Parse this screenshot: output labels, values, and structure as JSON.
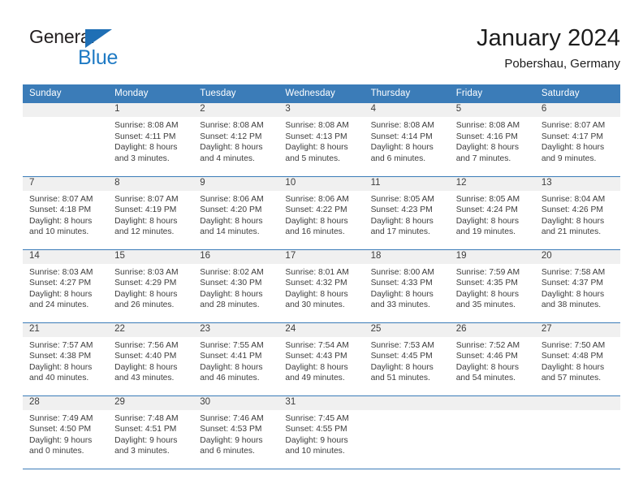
{
  "logo": {
    "word_dark": "General",
    "word_blue": "Blue",
    "triangle_color": "#1f6fb5",
    "blue_color": "#1f7ac4"
  },
  "header": {
    "title": "January 2024",
    "subtitle": "Pobershau, Germany"
  },
  "theme": {
    "header_blue": "#3b7cb8",
    "daynum_band": "#f0f0f0",
    "text": "#3d3d3d"
  },
  "labels": {
    "sunrise_prefix": "Sunrise:",
    "sunset_prefix": "Sunset:",
    "daylight_prefix": "Daylight:"
  },
  "weekday_headers": [
    "Sunday",
    "Monday",
    "Tuesday",
    "Wednesday",
    "Thursday",
    "Friday",
    "Saturday"
  ],
  "weeks": [
    [
      {
        "day": "",
        "empty": true,
        "lines": []
      },
      {
        "day": "1",
        "lines": [
          "Sunrise: 8:08 AM",
          "Sunset: 4:11 PM",
          "Daylight: 8 hours",
          "and 3 minutes."
        ]
      },
      {
        "day": "2",
        "lines": [
          "Sunrise: 8:08 AM",
          "Sunset: 4:12 PM",
          "Daylight: 8 hours",
          "and 4 minutes."
        ]
      },
      {
        "day": "3",
        "lines": [
          "Sunrise: 8:08 AM",
          "Sunset: 4:13 PM",
          "Daylight: 8 hours",
          "and 5 minutes."
        ]
      },
      {
        "day": "4",
        "lines": [
          "Sunrise: 8:08 AM",
          "Sunset: 4:14 PM",
          "Daylight: 8 hours",
          "and 6 minutes."
        ]
      },
      {
        "day": "5",
        "lines": [
          "Sunrise: 8:08 AM",
          "Sunset: 4:16 PM",
          "Daylight: 8 hours",
          "and 7 minutes."
        ]
      },
      {
        "day": "6",
        "lines": [
          "Sunrise: 8:07 AM",
          "Sunset: 4:17 PM",
          "Daylight: 8 hours",
          "and 9 minutes."
        ]
      }
    ],
    [
      {
        "day": "7",
        "lines": [
          "Sunrise: 8:07 AM",
          "Sunset: 4:18 PM",
          "Daylight: 8 hours",
          "and 10 minutes."
        ]
      },
      {
        "day": "8",
        "lines": [
          "Sunrise: 8:07 AM",
          "Sunset: 4:19 PM",
          "Daylight: 8 hours",
          "and 12 minutes."
        ]
      },
      {
        "day": "9",
        "lines": [
          "Sunrise: 8:06 AM",
          "Sunset: 4:20 PM",
          "Daylight: 8 hours",
          "and 14 minutes."
        ]
      },
      {
        "day": "10",
        "lines": [
          "Sunrise: 8:06 AM",
          "Sunset: 4:22 PM",
          "Daylight: 8 hours",
          "and 16 minutes."
        ]
      },
      {
        "day": "11",
        "lines": [
          "Sunrise: 8:05 AM",
          "Sunset: 4:23 PM",
          "Daylight: 8 hours",
          "and 17 minutes."
        ]
      },
      {
        "day": "12",
        "lines": [
          "Sunrise: 8:05 AM",
          "Sunset: 4:24 PM",
          "Daylight: 8 hours",
          "and 19 minutes."
        ]
      },
      {
        "day": "13",
        "lines": [
          "Sunrise: 8:04 AM",
          "Sunset: 4:26 PM",
          "Daylight: 8 hours",
          "and 21 minutes."
        ]
      }
    ],
    [
      {
        "day": "14",
        "lines": [
          "Sunrise: 8:03 AM",
          "Sunset: 4:27 PM",
          "Daylight: 8 hours",
          "and 24 minutes."
        ]
      },
      {
        "day": "15",
        "lines": [
          "Sunrise: 8:03 AM",
          "Sunset: 4:29 PM",
          "Daylight: 8 hours",
          "and 26 minutes."
        ]
      },
      {
        "day": "16",
        "lines": [
          "Sunrise: 8:02 AM",
          "Sunset: 4:30 PM",
          "Daylight: 8 hours",
          "and 28 minutes."
        ]
      },
      {
        "day": "17",
        "lines": [
          "Sunrise: 8:01 AM",
          "Sunset: 4:32 PM",
          "Daylight: 8 hours",
          "and 30 minutes."
        ]
      },
      {
        "day": "18",
        "lines": [
          "Sunrise: 8:00 AM",
          "Sunset: 4:33 PM",
          "Daylight: 8 hours",
          "and 33 minutes."
        ]
      },
      {
        "day": "19",
        "lines": [
          "Sunrise: 7:59 AM",
          "Sunset: 4:35 PM",
          "Daylight: 8 hours",
          "and 35 minutes."
        ]
      },
      {
        "day": "20",
        "lines": [
          "Sunrise: 7:58 AM",
          "Sunset: 4:37 PM",
          "Daylight: 8 hours",
          "and 38 minutes."
        ]
      }
    ],
    [
      {
        "day": "21",
        "lines": [
          "Sunrise: 7:57 AM",
          "Sunset: 4:38 PM",
          "Daylight: 8 hours",
          "and 40 minutes."
        ]
      },
      {
        "day": "22",
        "lines": [
          "Sunrise: 7:56 AM",
          "Sunset: 4:40 PM",
          "Daylight: 8 hours",
          "and 43 minutes."
        ]
      },
      {
        "day": "23",
        "lines": [
          "Sunrise: 7:55 AM",
          "Sunset: 4:41 PM",
          "Daylight: 8 hours",
          "and 46 minutes."
        ]
      },
      {
        "day": "24",
        "lines": [
          "Sunrise: 7:54 AM",
          "Sunset: 4:43 PM",
          "Daylight: 8 hours",
          "and 49 minutes."
        ]
      },
      {
        "day": "25",
        "lines": [
          "Sunrise: 7:53 AM",
          "Sunset: 4:45 PM",
          "Daylight: 8 hours",
          "and 51 minutes."
        ]
      },
      {
        "day": "26",
        "lines": [
          "Sunrise: 7:52 AM",
          "Sunset: 4:46 PM",
          "Daylight: 8 hours",
          "and 54 minutes."
        ]
      },
      {
        "day": "27",
        "lines": [
          "Sunrise: 7:50 AM",
          "Sunset: 4:48 PM",
          "Daylight: 8 hours",
          "and 57 minutes."
        ]
      }
    ],
    [
      {
        "day": "28",
        "lines": [
          "Sunrise: 7:49 AM",
          "Sunset: 4:50 PM",
          "Daylight: 9 hours",
          "and 0 minutes."
        ]
      },
      {
        "day": "29",
        "lines": [
          "Sunrise: 7:48 AM",
          "Sunset: 4:51 PM",
          "Daylight: 9 hours",
          "and 3 minutes."
        ]
      },
      {
        "day": "30",
        "lines": [
          "Sunrise: 7:46 AM",
          "Sunset: 4:53 PM",
          "Daylight: 9 hours",
          "and 6 minutes."
        ]
      },
      {
        "day": "31",
        "lines": [
          "Sunrise: 7:45 AM",
          "Sunset: 4:55 PM",
          "Daylight: 9 hours",
          "and 10 minutes."
        ]
      },
      {
        "day": "",
        "empty": true,
        "lines": []
      },
      {
        "day": "",
        "empty": true,
        "lines": []
      },
      {
        "day": "",
        "empty": true,
        "lines": []
      }
    ]
  ]
}
